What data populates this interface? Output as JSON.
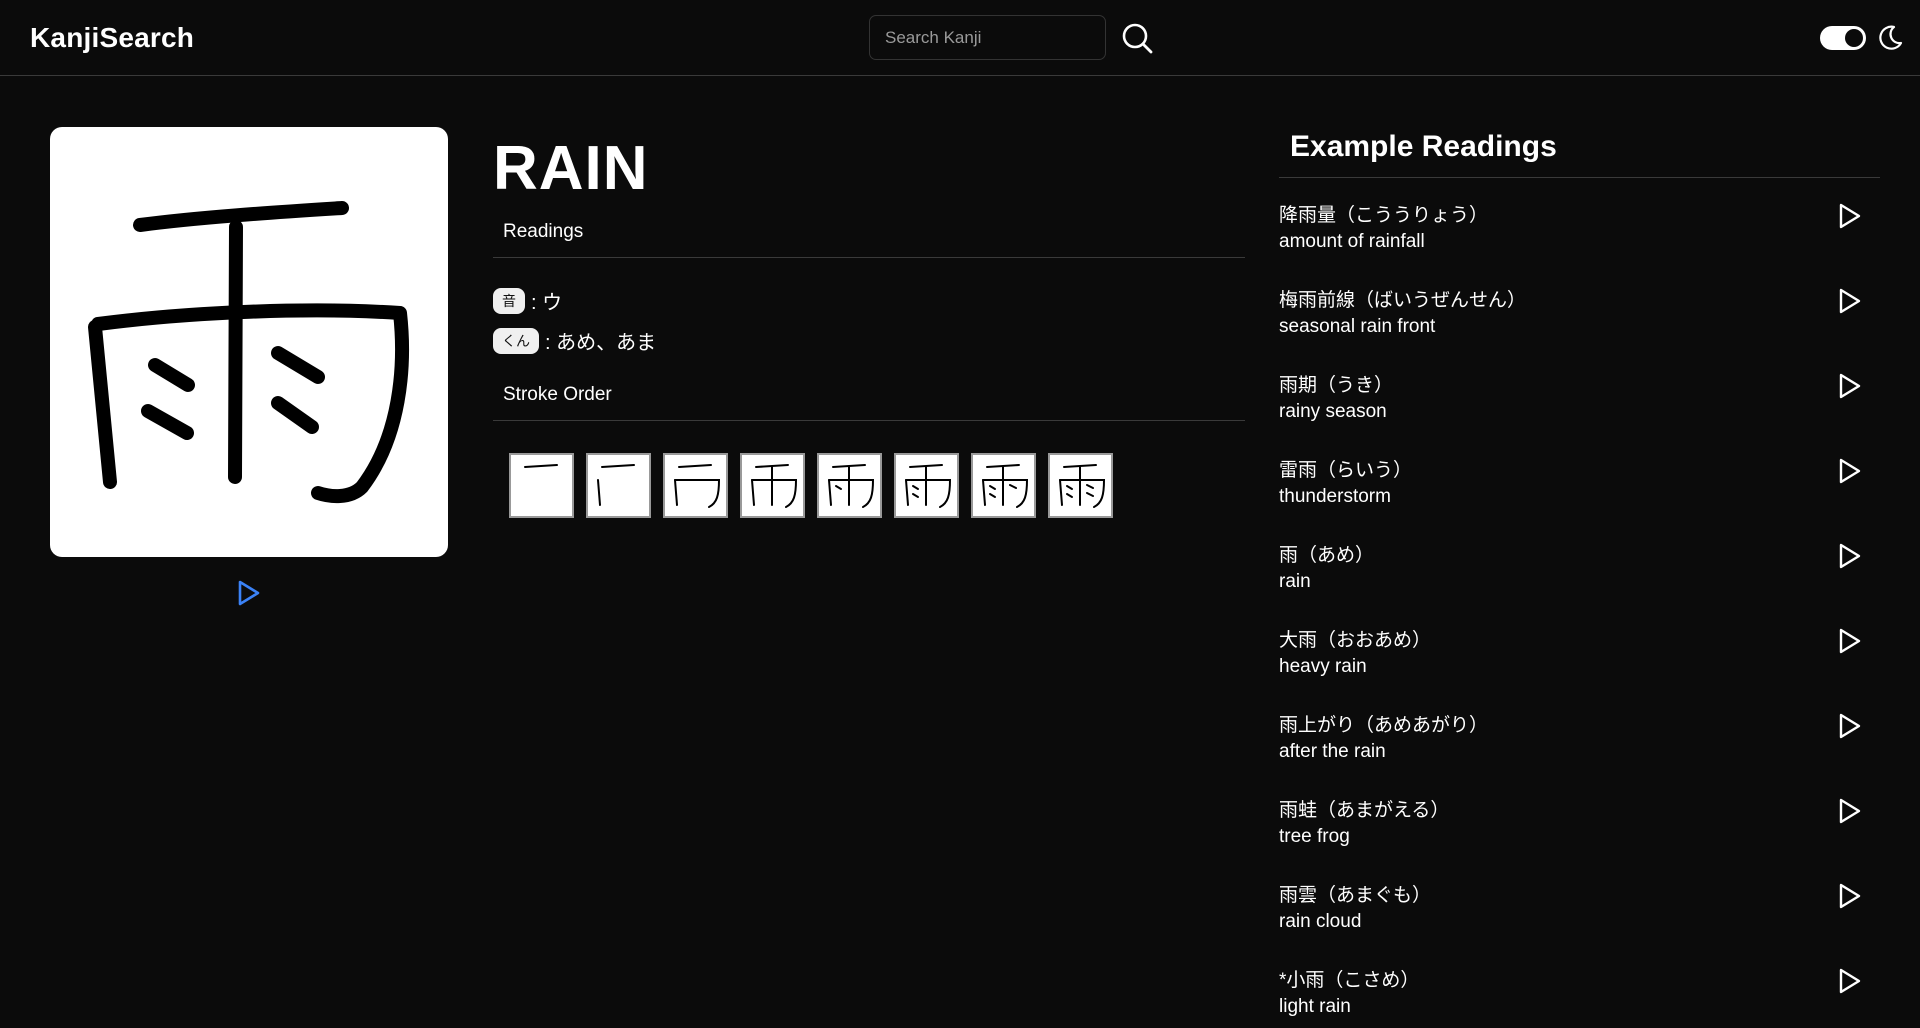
{
  "header": {
    "brand": "KanjiSearch",
    "search_placeholder": "Search Kanji",
    "search_icon": "search-icon",
    "theme_toggle_icon": "toggle-switch-icon",
    "dark_mode_icon": "moon-icon"
  },
  "kanji": {
    "character": "雨",
    "meaning": "RAIN",
    "play_icon": "play-icon",
    "accent_color": "#3b82f6"
  },
  "readings": {
    "title": "Readings",
    "on_label": "音",
    "on_value": ": ウ",
    "kun_label": "くん",
    "kun_value": ": あめ、あま"
  },
  "stroke_order": {
    "title": "Stroke Order",
    "count": 8
  },
  "examples": {
    "title": "Example Readings",
    "items": [
      {
        "word": "降雨量（こううりょう）",
        "meaning": "amount of rainfall"
      },
      {
        "word": "梅雨前線（ばいうぜんせん）",
        "meaning": "seasonal rain front"
      },
      {
        "word": "雨期（うき）",
        "meaning": "rainy season"
      },
      {
        "word": "雷雨（らいう）",
        "meaning": "thunderstorm"
      },
      {
        "word": "雨（あめ）",
        "meaning": "rain"
      },
      {
        "word": "大雨（おおあめ）",
        "meaning": "heavy rain"
      },
      {
        "word": "雨上がり（あめあがり）",
        "meaning": "after the rain"
      },
      {
        "word": "雨蛙（あまがえる）",
        "meaning": "tree frog"
      },
      {
        "word": "雨雲（あまぐも）",
        "meaning": "rain cloud"
      },
      {
        "word": "*小雨（こさめ）",
        "meaning": "light rain"
      }
    ]
  }
}
